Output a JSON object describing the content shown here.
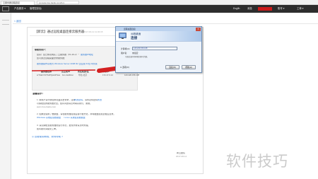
{
  "browser": {
    "tab_title": "云服务器远程连接",
    "url": "console.bce.baidu.com/bcc"
  },
  "topnav": {
    "product_menu": "产品服务 ▾",
    "workorder": "管理控制台",
    "region": "Englih",
    "messages": "消息",
    "account_menu": "账号 ▾",
    "help": "工单 ▾"
  },
  "breadcrumb": {
    "back": "< 返回"
  },
  "article": {
    "title": "【新云】通过远程桌面连接云服务器",
    "date": "2017-06-11 11:30:15",
    "greeting": "尊敬的用户：",
    "para1": "您好！您已成功购买了云服务器（X1-20-2）一台，",
    "para1_link": "服务器IP地址",
    "para2": "您可通过远程桌面登录服务器：",
    "para3": "服务器操作系统为 Windows Server 2008 R2 企业版 64位 中文版",
    "table_headers": [
      "服务器名称",
      "云主机ID",
      "所在机房/区",
      "内网IP",
      "公网IP"
    ],
    "table_row": [
      "srT3abY4rT6dPQwb4Tkaw1g",
      "bcc-4sdbbwi",
      "华北-北京",
      "172.17.0.14",
      "120.220.156.108"
    ],
    "section_heading": "温馨提示：",
    "tip1_line1": "1. 新用户请尽快在本页面点击登录，注意",
    "tip1_link1": "修改密码",
    "tip1_line1b": "，请务必将密码",
    "tip1_link2": "修改",
    "tip1_line2": "以保障您的服务器安全。如有问题请及时联系我们，谢谢。",
    "tip1_line3": "wwm.bce.baidu.com",
    "tip2_line1": "2. 如果您使用了数据盘，请在服务器挂载后进行格式化，并将磁盘挂载至相应目录。",
    "tip2_link": "Windows 系统挂载数据盘",
    "tip2_line2": "/ Linux 系统挂载数据盘",
    "tip3_line1": "3. 请定期检查服务器的运行状况，发现异常请及时处理。",
    "tip3_line2": "如有疑问请提交工单。",
    "footer_link": "◎ 查看使用教程，获得帮助 >",
    "signature": "新云团队",
    "signature_date": "2017-06-11"
  },
  "rdp_dialog": {
    "window_title": "远程桌面连接",
    "close": "✕",
    "banner_line1": "远程桌面",
    "banner_line2": "连接",
    "computer_label": "计算机(C):",
    "computer_value": "120.220.156.108",
    "user_label": "用户名:",
    "user_value": "未指定",
    "hint": "当您连接时将向您询问凭据。",
    "options_label": "⊙ 选项(O)",
    "connect_button": "连接(N)",
    "help_button": "帮助(H)"
  },
  "watermark": "软件技巧",
  "colors": {
    "topnav_bg": "#2d2d2d",
    "link": "#2f7bd6",
    "arrow": "#d42020",
    "dialog_title": "#bcd2ee"
  }
}
